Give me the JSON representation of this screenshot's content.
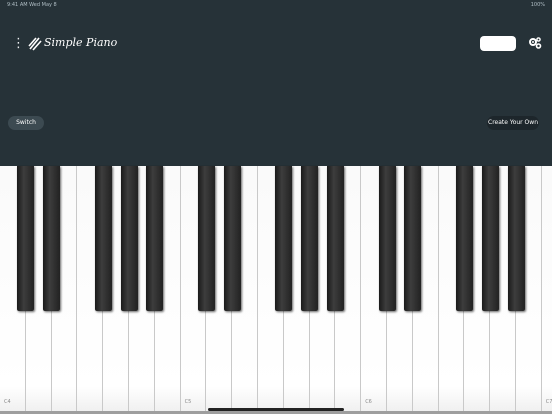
{
  "status": {
    "left": "9:41 AM   Wed May 8",
    "right": "100%"
  },
  "app": {
    "title": "Simple Piano"
  },
  "icons": {
    "menu": "more-vert-icon",
    "logo": "piano-logo-icon",
    "settings": "settings-gears-icon"
  },
  "buttons": {
    "switch": "Switch",
    "create": "Create Your Own"
  },
  "keyboard": {
    "white_labels": [
      "C4",
      "",
      "",
      "",
      "",
      "",
      "",
      "C5",
      "",
      "",
      "",
      "",
      "",
      "",
      "C6",
      "",
      "",
      "",
      "",
      "",
      "",
      "C7"
    ]
  }
}
